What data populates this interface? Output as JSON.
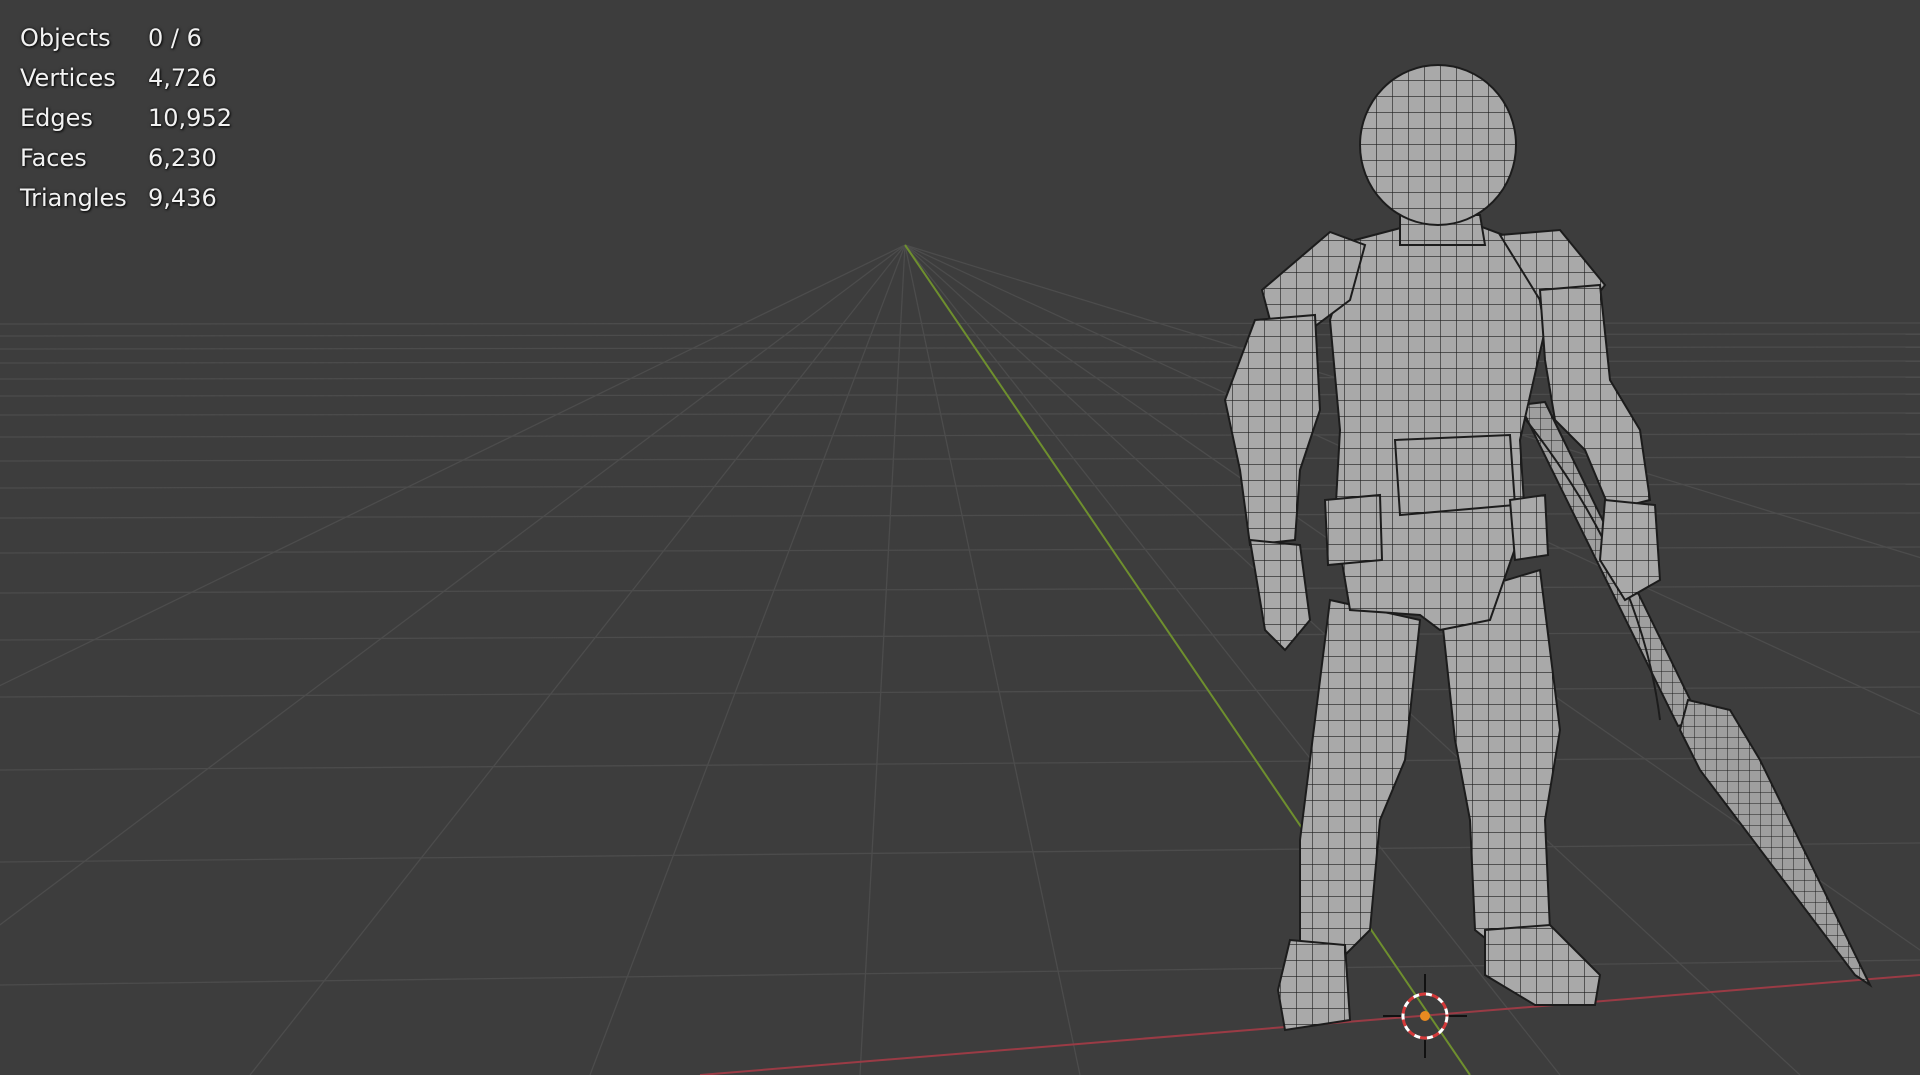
{
  "viewport": {
    "colors": {
      "background": "#3d3d3d",
      "grid": "#4c4c4c",
      "x_axis": "#9a3b45",
      "y_axis": "#6e8f2e",
      "mesh_fill": "#a9a9a9",
      "wire": "#1c1c1c",
      "cursor_center": "#e88a20"
    },
    "object": "armored-character-mesh",
    "cursor_icon": "3d-cursor-icon"
  },
  "stats": {
    "objects": {
      "label": "Objects",
      "value": "0 / 6"
    },
    "vertices": {
      "label": "Vertices",
      "value": "4,726"
    },
    "edges": {
      "label": "Edges",
      "value": "10,952"
    },
    "faces": {
      "label": "Faces",
      "value": "6,230"
    },
    "triangles": {
      "label": "Triangles",
      "value": "9,436"
    }
  }
}
